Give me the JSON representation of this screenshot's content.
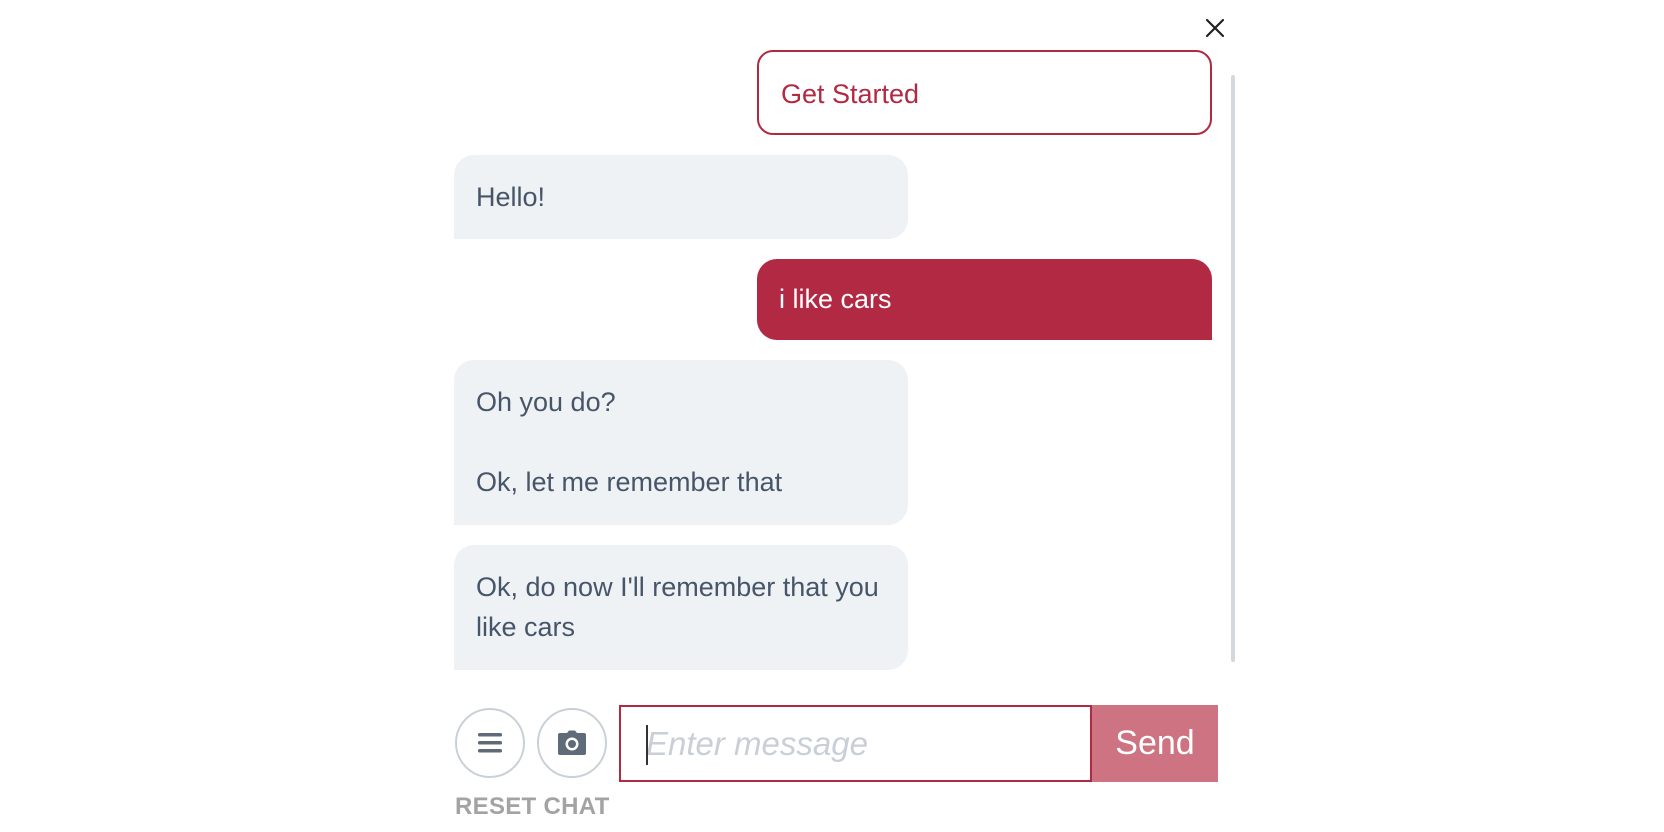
{
  "chat": {
    "quick_reply": "Get Started",
    "messages": [
      {
        "from": "bot",
        "paragraphs": [
          "Hello!"
        ]
      },
      {
        "from": "user",
        "text": "i like cars"
      },
      {
        "from": "bot",
        "paragraphs": [
          "Oh you do?",
          "Ok, let me remember that"
        ]
      },
      {
        "from": "bot",
        "paragraphs": [
          "Ok, do now I'll remember that you like cars"
        ]
      }
    ]
  },
  "composer": {
    "placeholder": "Enter message",
    "value": "",
    "send_label": "Send",
    "menu_icon": "menu-icon",
    "camera_icon": "camera-icon"
  },
  "reset_label": "RESET CHAT",
  "colors": {
    "accent": "#b22943",
    "send_disabled": "#cd7381",
    "bot_bubble": "#eff2f5",
    "bot_text": "#475568"
  }
}
